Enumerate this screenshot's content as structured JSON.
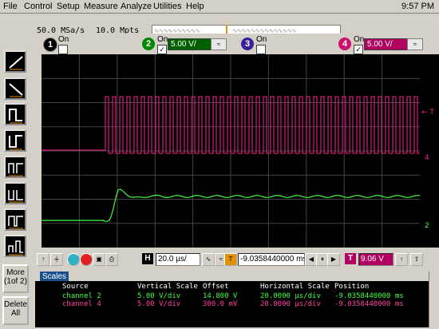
{
  "menu": {
    "items": [
      "File",
      "Control",
      "Setup",
      "Measure",
      "Analyze",
      "Utilities",
      "Help"
    ],
    "clock": "9:57 PM"
  },
  "acquisition": {
    "sample_rate": "50.0 MSa/s",
    "memory_depth": "10.0 Mpts"
  },
  "channels": [
    {
      "number": "1",
      "on_label": "On",
      "enabled": false,
      "color": "#ffffff",
      "scale": ""
    },
    {
      "number": "2",
      "on_label": "On",
      "enabled": true,
      "color": "#00c000",
      "scale": "5.00 V/"
    },
    {
      "number": "3",
      "on_label": "On",
      "enabled": false,
      "color": "#6030ff",
      "scale": ""
    },
    {
      "number": "4",
      "on_label": "On",
      "enabled": true,
      "color": "#ff2080",
      "scale": "5.00 V/"
    }
  ],
  "left_toolbar": {
    "more_label": "More",
    "more_page": "(1of 2)",
    "delete_line1": "Delete",
    "delete_line2": "All"
  },
  "display_markers": {
    "trigger_top": "← T",
    "ch4_marker": "4",
    "ch2_marker": "2"
  },
  "controls": {
    "horizontal_tag": "H",
    "time_scale": "20.0 µs/",
    "position": "-9.0358440000 ms",
    "trigger_tag": "T",
    "trigger_level": "9.06 V"
  },
  "scales": {
    "tab_label": "Scales",
    "headers": {
      "source": "Source",
      "vscale": "Vertical Scale",
      "offset": "Offset",
      "hscale": "Horizontal Scale",
      "position": "Position"
    },
    "rows": [
      {
        "source": "channel 2",
        "vscale": "5.00 V/div",
        "offset": "14.800 V",
        "hscale": "20.0000 µs/div",
        "position": "-9.0358440000 ms",
        "color": "#40ff40"
      },
      {
        "source": "channel 4",
        "vscale": "5.00 V/div",
        "offset": "300.0 mV",
        "hscale": "20.0000 µs/div",
        "position": "-9.0358440000 ms",
        "color": "#ff40a0"
      }
    ]
  },
  "colors": {
    "ch2_trace": "#40ff40",
    "ch4_trace": "#ff2090",
    "grid": "#444444",
    "trigger_orange": "#e09000"
  }
}
